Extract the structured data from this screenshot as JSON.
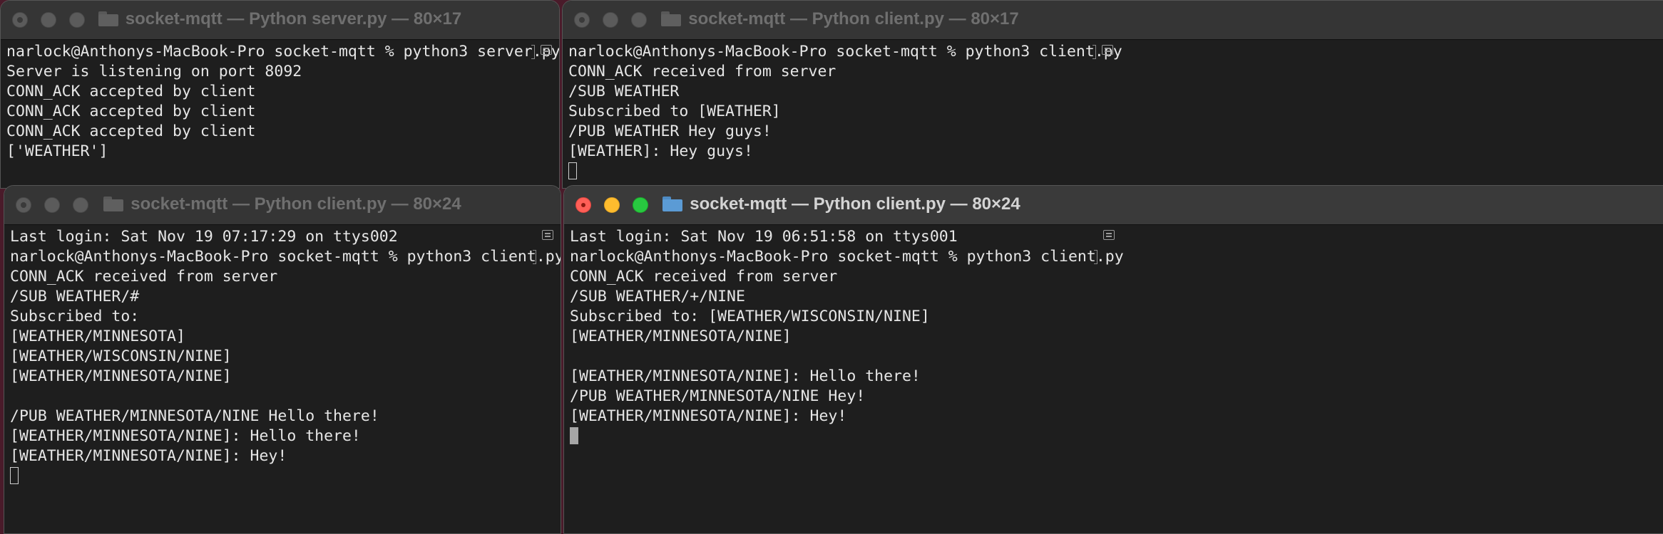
{
  "windows": {
    "server": {
      "title": "socket-mqtt — Python server.py — 80×17",
      "lines": [
        "narlock@Anthonys-MacBook-Pro socket-mqtt % python3 server.py",
        "Server is listening on port 8092",
        "CONN_ACK accepted by client",
        "CONN_ACK accepted by client",
        "CONN_ACK accepted by client",
        "['WEATHER']"
      ]
    },
    "client_tr": {
      "title": "socket-mqtt — Python client.py — 80×17",
      "lines": [
        "narlock@Anthonys-MacBook-Pro socket-mqtt % python3 client.py",
        "CONN_ACK received from server",
        "/SUB WEATHER",
        "Subscribed to [WEATHER]",
        "/PUB WEATHER Hey guys!",
        "[WEATHER]: Hey guys!"
      ]
    },
    "client_bl": {
      "title": "socket-mqtt — Python client.py — 80×24",
      "lines": [
        "Last login: Sat Nov 19 07:17:29 on ttys002",
        "narlock@Anthonys-MacBook-Pro socket-mqtt % python3 client.py",
        "CONN_ACK received from server",
        "/SUB WEATHER/#",
        "Subscribed to:",
        "[WEATHER/MINNESOTA]",
        "[WEATHER/WISCONSIN/NINE]",
        "[WEATHER/MINNESOTA/NINE]",
        "",
        "/PUB WEATHER/MINNESOTA/NINE Hello there!",
        "[WEATHER/MINNESOTA/NINE]: Hello there!",
        "[WEATHER/MINNESOTA/NINE]: Hey!"
      ]
    },
    "client_br": {
      "title": "socket-mqtt — Python client.py — 80×24",
      "lines": [
        "Last login: Sat Nov 19 06:51:58 on ttys001",
        "narlock@Anthonys-MacBook-Pro socket-mqtt % python3 client.py",
        "CONN_ACK received from server",
        "/SUB WEATHER/+/NINE",
        "Subscribed to: [WEATHER/WISCONSIN/NINE]",
        "[WEATHER/MINNESOTA/NINE]",
        "",
        "[WEATHER/MINNESOTA/NINE]: Hello there!",
        "/PUB WEATHER/MINNESOTA/NINE Hey!",
        "[WEATHER/MINNESOTA/NINE]: Hey!"
      ]
    }
  },
  "icons": {
    "traffic_lights": [
      "close-icon",
      "minimize-icon",
      "zoom-icon"
    ],
    "folder": "folder-icon",
    "scroll_mark": "mark-icon"
  },
  "colors": {
    "terminal_bg": "#1e1e1e",
    "text": "#e6e6e6",
    "close": "#ff5f57",
    "minimize": "#febc2e",
    "zoom": "#28c840",
    "folder": "#5b9bd5"
  }
}
